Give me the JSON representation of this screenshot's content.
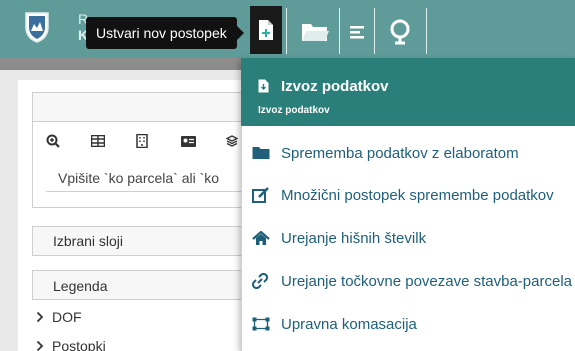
{
  "app": {
    "brand_line1": "R",
    "brand_line2": "K"
  },
  "toolbar": {
    "tooltip": "Ustvari nov postopek",
    "buttons": [
      {
        "name": "new-procedure",
        "icon": "file-plus-icon"
      },
      {
        "name": "open-folder",
        "icon": "folder-open-icon"
      },
      {
        "name": "menu",
        "icon": "list-icon"
      },
      {
        "name": "map",
        "icon": "globe-icon"
      }
    ]
  },
  "left_panel": {
    "tabs": [
      "zoom-in-icon",
      "table-icon",
      "building-icon",
      "id-card-icon",
      "layers-icon"
    ],
    "search_placeholder": "Vpišite `ko parcela` ali `ko",
    "selected_layers": "Izbrani sloji",
    "legend": "Legenda",
    "tree": [
      "DOF",
      "Postopki"
    ]
  },
  "dropdown": {
    "header_title": "Izvoz podatkov",
    "header_sub": "Izvoz podatkov",
    "items": [
      {
        "label": "Sprememba podatkov z elaboratom",
        "icon": "folder-icon"
      },
      {
        "label": "Množični postopek spremembe podatkov",
        "icon": "edit-icon"
      },
      {
        "label": "Urejanje hišnih številk",
        "icon": "home-icon"
      },
      {
        "label": "Urejanje točkovne povezave stavba-parcela",
        "icon": "link-icon"
      },
      {
        "label": "Upravna komasacija",
        "icon": "vector-square-icon"
      }
    ]
  },
  "colors": {
    "topbar": "#5f9c99",
    "dropdown_header": "#2b7f7b",
    "item_text": "#1f5f7a"
  }
}
